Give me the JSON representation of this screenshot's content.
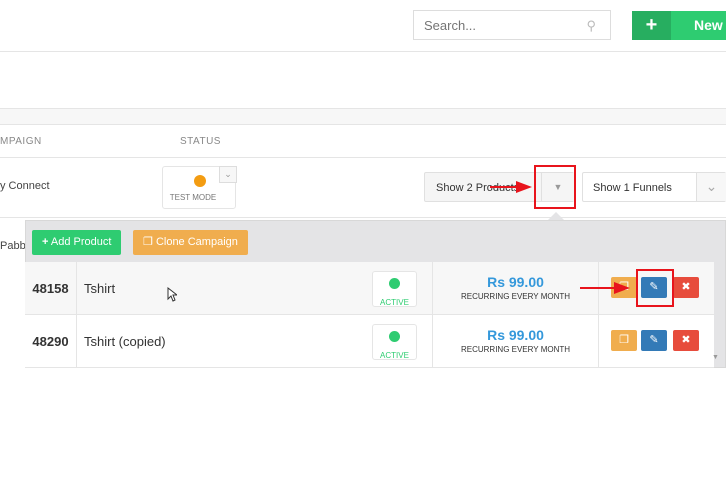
{
  "header": {
    "search_placeholder": "Search...",
    "new_button_label": "New"
  },
  "table": {
    "headers": [
      "MPAIGN",
      "STATUS"
    ],
    "rows": [
      {
        "campaign": "y Connect",
        "status": "TEST MODE",
        "products_select": "Show 2 Products",
        "funnels_select": "Show 1 Funnels"
      },
      {
        "campaign": "Pabbl"
      }
    ]
  },
  "panel": {
    "add_product_label": "Add Product",
    "clone_campaign_label": "Clone Campaign",
    "products": [
      {
        "id": "48158",
        "name": "Tshirt",
        "status": "ACTIVE",
        "price": "Rs 99.00",
        "recurring": "RECURRING EVERY MONTH"
      },
      {
        "id": "48290",
        "name": "Tshirt (copied)",
        "status": "ACTIVE",
        "price": "Rs 99.00",
        "recurring": "RECURRING EVERY MONTH"
      }
    ]
  },
  "colors": {
    "green": "#2ecc71",
    "orange": "#f0ad4e",
    "blue": "#337ab7",
    "red": "#e74c3c",
    "price_blue": "#3498db",
    "annotation_red": "#e8141c",
    "test_mode": "#f39c12"
  }
}
